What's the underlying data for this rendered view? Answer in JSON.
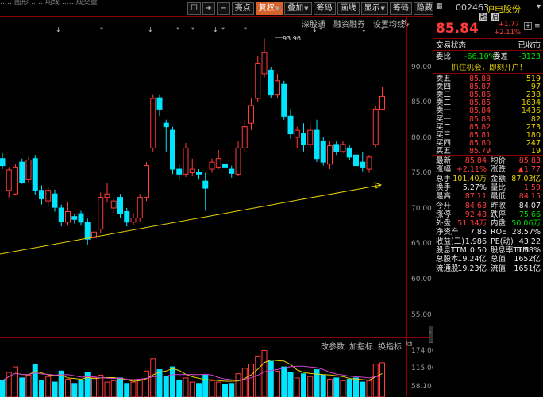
{
  "toolbar": {
    "buttons": [
      "亮点",
      "复权",
      "叠加",
      "筹码",
      "画线",
      "显示",
      "筹码",
      "隐藏"
    ],
    "selected": "复权"
  },
  "top_left_text": "……图形   ……均线   ……成交量",
  "subtabs": [
    "深股通",
    "融资融券",
    "设置均线"
  ],
  "price_axis": [
    "90.00",
    "85.00",
    "80.00",
    "75.00",
    "70.00",
    "65.00",
    "60.00",
    "55.00"
  ],
  "vol_axis": [
    "174.00",
    "115.00",
    "58.10"
  ],
  "indicator_tabs": [
    "改参数",
    "加指标",
    "换指标"
  ],
  "high_marker": "93.96",
  "candles": [
    {
      "o": 77.0,
      "c": 76.0,
      "h": 77.8,
      "l": 75.5
    },
    {
      "o": 72.5,
      "c": 75.4,
      "h": 75.8,
      "l": 71.5
    },
    {
      "o": 72.0,
      "c": 75.8,
      "h": 76.2,
      "l": 71.8
    },
    {
      "o": 76.5,
      "c": 73.6,
      "h": 77.0,
      "l": 73.4
    },
    {
      "o": 74.0,
      "c": 76.8,
      "h": 77.2,
      "l": 73.5
    },
    {
      "o": 77.0,
      "c": 72.5,
      "h": 77.5,
      "l": 71.8
    },
    {
      "o": 72.5,
      "c": 71.3,
      "h": 73.2,
      "l": 70.5
    },
    {
      "o": 71.0,
      "c": 72.5,
      "h": 73.0,
      "l": 70.2
    },
    {
      "o": 72.0,
      "c": 70.1,
      "h": 72.6,
      "l": 69.5
    },
    {
      "o": 70.0,
      "c": 68.1,
      "h": 70.5,
      "l": 67.4
    },
    {
      "o": 68.0,
      "c": 69.5,
      "h": 70.8,
      "l": 67.5
    },
    {
      "o": 68.8,
      "c": 68.4,
      "h": 69.2,
      "l": 67.8
    },
    {
      "o": 69.2,
      "c": 68.0,
      "h": 69.6,
      "l": 67.5
    },
    {
      "o": 68.0,
      "c": 65.6,
      "h": 68.5,
      "l": 64.8
    },
    {
      "o": 65.8,
      "c": 66.6,
      "h": 71.0,
      "l": 64.9
    },
    {
      "o": 67.0,
      "c": 71.5,
      "h": 72.2,
      "l": 66.5
    },
    {
      "o": 71.5,
      "c": 72.0,
      "h": 73.5,
      "l": 70.8
    },
    {
      "o": 70.0,
      "c": 71.0,
      "h": 71.5,
      "l": 69.3
    },
    {
      "o": 71.5,
      "c": 69.2,
      "h": 72.0,
      "l": 68.6
    },
    {
      "o": 69.5,
      "c": 68.0,
      "h": 70.0,
      "l": 67.4
    },
    {
      "o": 68.0,
      "c": 68.6,
      "h": 69.3,
      "l": 67.5
    },
    {
      "o": 68.6,
      "c": 71.5,
      "h": 72.0,
      "l": 68.0
    },
    {
      "o": 71.5,
      "c": 76.0,
      "h": 76.5,
      "l": 71.0
    },
    {
      "o": 78.5,
      "c": 85.5,
      "h": 86.0,
      "l": 78.0
    },
    {
      "o": 85.6,
      "c": 84.0,
      "h": 86.0,
      "l": 83.0
    },
    {
      "o": 82.0,
      "c": 81.5,
      "h": 82.5,
      "l": 78.0
    },
    {
      "o": 81.0,
      "c": 75.5,
      "h": 81.5,
      "l": 74.8
    },
    {
      "o": 75.5,
      "c": 74.8,
      "h": 76.2,
      "l": 74.0
    },
    {
      "o": 74.8,
      "c": 78.5,
      "h": 79.2,
      "l": 74.4
    },
    {
      "o": 75.0,
      "c": 75.5,
      "h": 77.0,
      "l": 74.5
    },
    {
      "o": 75.0,
      "c": 74.8,
      "h": 75.5,
      "l": 74.0
    },
    {
      "o": 73.8,
      "c": 72.8,
      "h": 75.0,
      "l": 69.6
    },
    {
      "o": 75.5,
      "c": 76.5,
      "h": 77.0,
      "l": 75.0
    },
    {
      "o": 75.8,
      "c": 77.0,
      "h": 78.2,
      "l": 75.5
    },
    {
      "o": 76.2,
      "c": 75.8,
      "h": 77.0,
      "l": 75.0
    },
    {
      "o": 75.5,
      "c": 74.9,
      "h": 76.0,
      "l": 74.3
    },
    {
      "o": 74.8,
      "c": 78.5,
      "h": 79.5,
      "l": 74.5
    },
    {
      "o": 78.5,
      "c": 81.5,
      "h": 82.5,
      "l": 78.0
    },
    {
      "o": 82.0,
      "c": 84.5,
      "h": 85.5,
      "l": 81.0
    },
    {
      "o": 85.5,
      "c": 90.5,
      "h": 91.5,
      "l": 85.0
    },
    {
      "o": 89.0,
      "c": 92.0,
      "h": 94.0,
      "l": 88.5
    },
    {
      "o": 89.5,
      "c": 86.0,
      "h": 90.0,
      "l": 85.5
    },
    {
      "o": 86.0,
      "c": 88.0,
      "h": 89.0,
      "l": 85.5
    },
    {
      "o": 87.5,
      "c": 83.0,
      "h": 88.0,
      "l": 82.5
    },
    {
      "o": 83.0,
      "c": 80.5,
      "h": 84.0,
      "l": 79.8
    },
    {
      "o": 80.0,
      "c": 81.0,
      "h": 81.5,
      "l": 78.5
    },
    {
      "o": 80.5,
      "c": 79.0,
      "h": 82.0,
      "l": 78.0
    },
    {
      "o": 79.0,
      "c": 81.0,
      "h": 82.0,
      "l": 78.5
    },
    {
      "o": 81.0,
      "c": 77.0,
      "h": 82.5,
      "l": 76.5
    },
    {
      "o": 79.5,
      "c": 76.5,
      "h": 80.0,
      "l": 76.0
    },
    {
      "o": 76.2,
      "c": 78.8,
      "h": 79.5,
      "l": 75.5
    },
    {
      "o": 79.0,
      "c": 78.0,
      "h": 79.5,
      "l": 77.5
    },
    {
      "o": 78.0,
      "c": 79.0,
      "h": 79.5,
      "l": 77.8
    },
    {
      "o": 78.5,
      "c": 77.2,
      "h": 79.0,
      "l": 76.8
    },
    {
      "o": 77.5,
      "c": 76.0,
      "h": 78.5,
      "l": 75.5
    },
    {
      "o": 76.5,
      "c": 75.8,
      "h": 78.0,
      "l": 75.2
    },
    {
      "o": 75.5,
      "c": 77.2,
      "h": 77.5,
      "l": 75.0
    },
    {
      "o": 79.0,
      "c": 84.0,
      "h": 84.5,
      "l": 78.6
    },
    {
      "o": 84.0,
      "c": 85.8,
      "h": 87.1,
      "l": 84.2
    }
  ],
  "volumes": [
    60,
    90,
    110,
    70,
    80,
    120,
    60,
    75,
    55,
    95,
    65,
    50,
    60,
    90,
    70,
    80,
    55,
    60,
    70,
    50,
    55,
    65,
    95,
    140,
    100,
    75,
    110,
    60,
    70,
    55,
    50,
    80,
    60,
    55,
    45,
    50,
    85,
    105,
    120,
    150,
    170,
    130,
    95,
    110,
    90,
    70,
    85,
    75,
    100,
    80,
    65,
    70,
    60,
    65,
    70,
    55,
    60,
    120,
    125
  ],
  "stock": {
    "code": "002463",
    "name": "沪电股份",
    "badge_rong": "融",
    "badge_qi": "启",
    "price": "85.84",
    "change": "+1.77",
    "change_pct": "+2.11%",
    "trade_status_label": "交易状态",
    "trade_status_value": "已收市",
    "weibi_label": "委比",
    "weibi_value": "-66.10%",
    "weicha_label": "委差",
    "weicha_value": "-3123",
    "promo": "抓住机会，即刻开户！",
    "sells": [
      {
        "label": "卖五",
        "price": "85.88",
        "vol": "519"
      },
      {
        "label": "卖四",
        "price": "85.87",
        "vol": "97"
      },
      {
        "label": "卖三",
        "price": "85.86",
        "vol": "238"
      },
      {
        "label": "卖二",
        "price": "85.85",
        "vol": "1634"
      },
      {
        "label": "卖一",
        "price": "85.84",
        "vol": "1436"
      }
    ],
    "buys": [
      {
        "label": "买一",
        "price": "85.83",
        "vol": "82"
      },
      {
        "label": "买二",
        "price": "85.82",
        "vol": "273"
      },
      {
        "label": "买三",
        "price": "85.81",
        "vol": "180"
      },
      {
        "label": "买四",
        "price": "85.80",
        "vol": "247"
      },
      {
        "label": "买五",
        "price": "85.79",
        "vol": "19"
      }
    ],
    "stats": [
      [
        {
          "l": "最新",
          "v": "85.84",
          "c": "red"
        },
        {
          "l": "均价",
          "v": "85.83",
          "c": "red"
        }
      ],
      [
        {
          "l": "涨幅",
          "v": "+2.11%",
          "c": "red",
          "arrow": "up"
        },
        {
          "l": "涨跌",
          "v": "1.77",
          "c": "red",
          "arrow": "up"
        }
      ],
      [
        {
          "l": "总手",
          "v": "101.40万",
          "c": "yel"
        },
        {
          "l": "金额",
          "v": "87.03亿",
          "c": "yel"
        }
      ],
      [
        {
          "l": "换手",
          "v": "5.27%",
          "c": "wht"
        },
        {
          "l": "量比",
          "v": "1.59",
          "c": "red"
        }
      ],
      [
        {
          "l": "最高",
          "v": "87.11",
          "c": "red"
        },
        {
          "l": "最低",
          "v": "84.15",
          "c": "red"
        }
      ],
      [
        {
          "l": "今开",
          "v": "84.68",
          "c": "red"
        },
        {
          "l": "昨收",
          "v": "84.07",
          "c": "wht"
        }
      ],
      [
        {
          "l": "涨停",
          "v": "92.48",
          "c": "red"
        },
        {
          "l": "跌停",
          "v": "75.66",
          "c": "grn"
        }
      ],
      [
        {
          "l": "外盘",
          "v": "51.34万",
          "c": "red"
        },
        {
          "l": "内盘",
          "v": "50.06万",
          "c": "grn"
        }
      ],
      [
        {
          "l": "净资产",
          "v": "7.85",
          "c": "wht"
        },
        {
          "l": "ROE",
          "v": "28.57%",
          "c": "wht"
        }
      ],
      [
        {
          "l": "收益(三)",
          "v": "1.986",
          "c": "wht"
        },
        {
          "l": "PE(动)",
          "v": "43.22",
          "c": "wht"
        }
      ],
      [
        {
          "l": "股息TTM",
          "v": "0.50",
          "c": "wht"
        },
        {
          "l": "股息率TTM",
          "v": "0.58%",
          "c": "wht"
        }
      ],
      [
        {
          "l": "总股本",
          "v": "19.24亿",
          "c": "wht"
        },
        {
          "l": "总值",
          "v": "1652亿",
          "c": "wht"
        }
      ],
      [
        {
          "l": "流通股",
          "v": "19.23亿",
          "c": "wht"
        },
        {
          "l": "流值",
          "v": "1651亿",
          "c": "wht"
        }
      ]
    ]
  }
}
